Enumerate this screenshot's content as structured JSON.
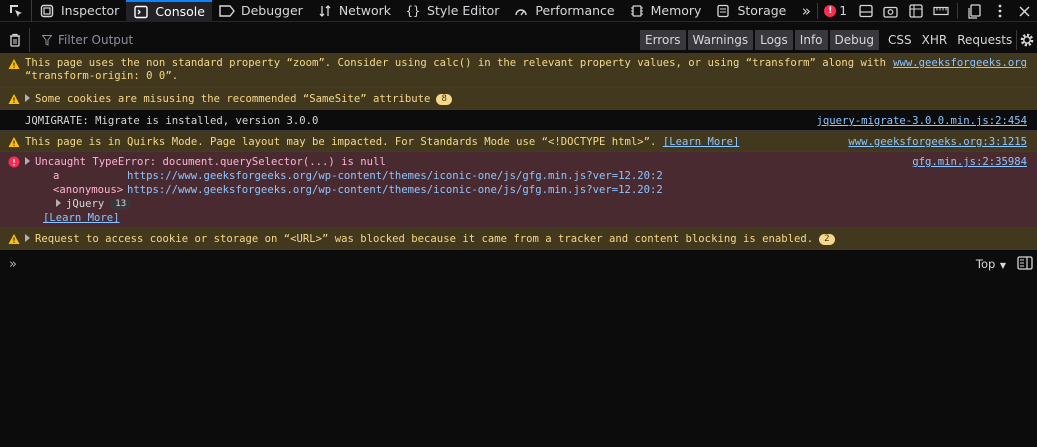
{
  "tabs": [
    {
      "label": "Inspector",
      "icon": "inspector-icon"
    },
    {
      "label": "Console",
      "icon": "console-icon",
      "active": true
    },
    {
      "label": "Debugger",
      "icon": "debugger-icon"
    },
    {
      "label": "Network",
      "icon": "network-icon"
    },
    {
      "label": "Style Editor",
      "icon": "style-editor-icon"
    },
    {
      "label": "Performance",
      "icon": "performance-icon"
    },
    {
      "label": "Memory",
      "icon": "memory-icon"
    },
    {
      "label": "Storage",
      "icon": "storage-icon"
    }
  ],
  "tab_overflow": "»",
  "error_count": "1",
  "filter": {
    "placeholder": "Filter Output",
    "buttons": [
      "Errors",
      "Warnings",
      "Logs",
      "Info",
      "Debug"
    ],
    "net_buttons": [
      "CSS",
      "XHR",
      "Requests"
    ]
  },
  "messages": {
    "m1": {
      "line1": "This page uses the non standard property “zoom”. Consider using calc() in the relevant property values, or using “transform” along with",
      "line2": "“transform-origin: 0 0”.",
      "source": "www.geeksforgeeks.org"
    },
    "m2": {
      "text": "Some cookies are misusing the recommended “SameSite” attribute",
      "count": "8"
    },
    "m3": {
      "text": "JQMIGRATE: Migrate is installed, version 3.0.0",
      "source": "jquery-migrate-3.0.0.min.js:2:454"
    },
    "m4": {
      "text": "This page is in Quirks Mode. Page layout may be impacted. For Standards Mode use “<!DOCTYPE html>”.",
      "learn_more": "[Learn More]",
      "source": "www.geeksforgeeks.org:3:1215"
    },
    "m5": {
      "text": "Uncaught TypeError: document.querySelector(...) is null",
      "source": "gfg.min.js:2:35984",
      "trace": [
        {
          "fn": "a",
          "url": "https://www.geeksforgeeks.org/wp-content/themes/iconic-one/js/gfg.min.js?ver=12.20:2"
        },
        {
          "fn": "<anonymous>",
          "url": "https://www.geeksforgeeks.org/wp-content/themes/iconic-one/js/gfg.min.js?ver=12.20:2"
        }
      ],
      "jquery_label": "jQuery",
      "jquery_count": "13",
      "learn_more": "[Learn More]"
    },
    "m6": {
      "text": "Request to access cookie or storage on “<URL>” was blocked because it came from a tracker and content blocking is enabled.",
      "count": "2"
    }
  },
  "input": {
    "prompt": "»",
    "context": "Top"
  },
  "colors": {
    "accent": "#0a84ff",
    "warning_bg": "#42381d",
    "error_bg": "#4a2a31",
    "error_icon": "#ff2a4f",
    "warning_icon": "#ffbf00"
  }
}
